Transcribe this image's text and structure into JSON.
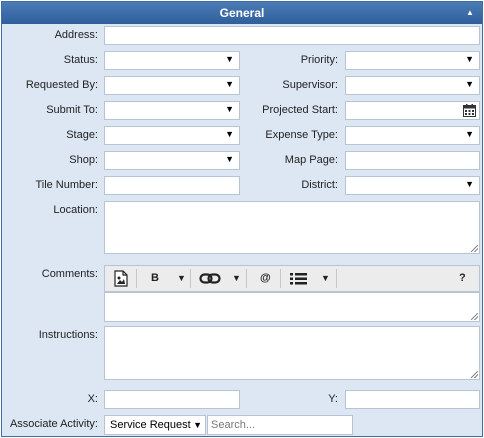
{
  "header": {
    "title": "General",
    "collapse_icon": "chevron-up-icon"
  },
  "labels": {
    "address": "Address:",
    "status": "Status:",
    "priority": "Priority:",
    "requested_by": "Requested By:",
    "supervisor": "Supervisor:",
    "submit_to": "Submit To:",
    "projected_start": "Projected Start:",
    "stage": "Stage:",
    "expense_type": "Expense Type:",
    "shop": "Shop:",
    "map_page": "Map Page:",
    "tile_number": "Tile Number:",
    "district": "District:",
    "location": "Location:",
    "comments": "Comments:",
    "instructions": "Instructions:",
    "x": "X:",
    "y": "Y:",
    "associate_activity": "Associate Activity:"
  },
  "toolbar": {
    "bold": "B",
    "mention": "@",
    "help": "?"
  },
  "associate_activity": {
    "selected": "Service Request",
    "search_placeholder": "Search..."
  }
}
